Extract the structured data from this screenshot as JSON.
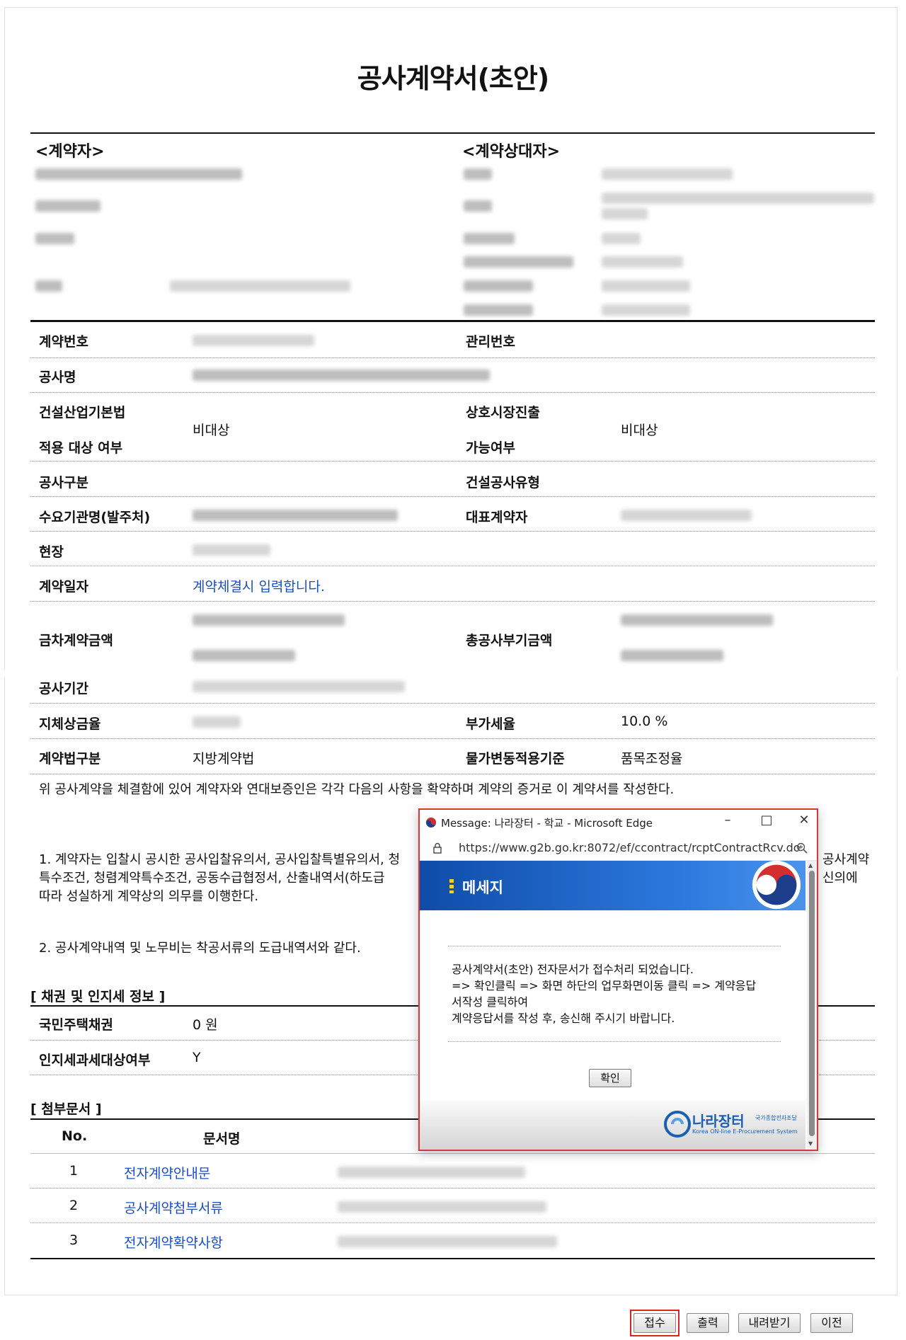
{
  "document": {
    "title": "공사계약서(초안)",
    "contractor_heading": "<계약자>",
    "counterparty_heading": "<계약상대자>",
    "fields": {
      "contract_no": {
        "label": "계약번호"
      },
      "management_no": {
        "label": "관리번호"
      },
      "project_name": {
        "label": "공사명"
      },
      "construction_law_line1": {
        "label": "건설산업기본법"
      },
      "construction_law_line2": {
        "label": "적용 대상 여부"
      },
      "construction_law_value": "비대상",
      "mutual_market_line1": {
        "label": "상호시장진출"
      },
      "mutual_market_line2": {
        "label": "가능여부"
      },
      "mutual_market_value": "비대상",
      "work_category": {
        "label": "공사구분"
      },
      "construction_type": {
        "label": "건설공사유형"
      },
      "client_org": {
        "label": "수요기관명(발주처)"
      },
      "rep_contractor": {
        "label": "대표계약자"
      },
      "site": {
        "label": "현장"
      },
      "contract_date": {
        "label": "계약일자",
        "value": "계약체결시 입력합니다."
      },
      "current_amount": {
        "label": "금차계약금액"
      },
      "total_amount": {
        "label": "총공사부기금액"
      },
      "period": {
        "label": "공사기간"
      },
      "delay_penalty": {
        "label": "지체상금율"
      },
      "vat_rate": {
        "label": "부가세율",
        "value": "10.0 %"
      },
      "contract_law": {
        "label": "계약법구분",
        "value": "지방계약법"
      },
      "price_change": {
        "label": "물가변동적용기준",
        "value": "품목조정율"
      }
    },
    "intro_text": "위 공사계약을 체결함에 있어 계약자와 연대보증인은 각각 다음의 사항을 확약하며 계약의 증거로 이 계약서를 작성한다.",
    "clause1_a": "1. 계약자는 입찰시 공시한 공사입찰유의서, 공사입찰특별유의서, 청",
    "clause1_a_tail": "공사계약",
    "clause1_b": "특수조건, 청렴계약특수조건, 공동수급협정서, 산출내역서(하도급 ",
    "clause1_b_tail": "신의에",
    "clause1_c": "따라 성실하게 계약상의 의무를 이행한다.",
    "clause2": "2. 공사계약내역 및 노무비는 착공서류의 도급내역서와 같다.",
    "bond_heading": "[ 채권 및 인지세 정보 ]",
    "housing_bond": {
      "label": "국민주택채권",
      "value": "0 원"
    },
    "stamp_tax": {
      "label": "인지세과세대상여부",
      "value": "Y"
    },
    "attachments_heading": "[ 첨부문서 ]",
    "attach_columns": {
      "no": "No.",
      "name": "문서명"
    },
    "attachments": [
      {
        "no": "1",
        "name": "전자계약안내문"
      },
      {
        "no": "2",
        "name": "공사계약첨부서류"
      },
      {
        "no": "3",
        "name": "전자계약확약사항"
      }
    ]
  },
  "buttons": {
    "receive": "접수",
    "print": "출력",
    "download": "내려받기",
    "prev": "이전"
  },
  "popup": {
    "window_title": "Message: 나라장터 - 학교 - Microsoft Edge",
    "url": "https://www.g2b.go.kr:8072/ef/ccontract/rcptContractRcv.do",
    "header": "메세지",
    "message_line1": "공사계약서(초안) 전자문서가 접수처리 되었습니다.",
    "message_line2": "=> 확인클릭 => 화면 하단의 업무화면이동 클릭 => 계약응답",
    "message_line3": "서작성 클릭하여",
    "message_line4": "계약응답서를 작성 후, 송신해 주시기 바랍니다.",
    "confirm": "확인",
    "logo_name": "나라장터",
    "logo_sub1": "국가종합전자조달",
    "logo_sub2": "Korea ON-line E-Procurement System"
  },
  "colors": {
    "link": "#1a4fc4",
    "highlight": "#d9251d",
    "popup_header": "#1f63c6"
  }
}
